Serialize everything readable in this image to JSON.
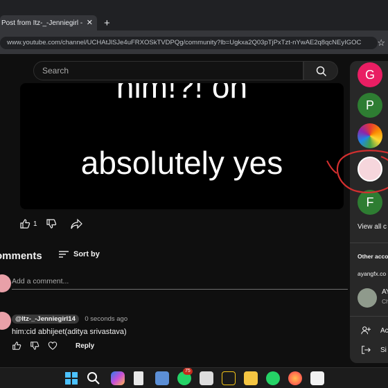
{
  "browser": {
    "tab_title": "Post from Itz-_-Jenniegirl - You",
    "tab_close": "✕",
    "new_tab": "+",
    "url": "www.youtube.com/channel/UCHAtJlSJe4uFRXOSkTVDPQg/community?lb=Ugkxa2Q03pTjPxTzt-nYwAE2q8qcNEyIGOC"
  },
  "header": {
    "search_placeholder": "Search"
  },
  "post": {
    "line1": "him!?! oh",
    "line2": "absolutely yes",
    "like_count": "1"
  },
  "comments": {
    "heading": "omments",
    "sort_label": "Sort by",
    "add_placeholder": "Add a comment...",
    "items": [
      {
        "handle": "@Itz-_-Jenniegirl14",
        "time": "0 seconds ago",
        "text": "him:cid abhijeet(aditya srivastava)",
        "reply_label": "Reply"
      }
    ]
  },
  "account_panel": {
    "accounts": [
      {
        "letter": "G",
        "color": "#e91e63"
      },
      {
        "letter": "P",
        "color": "#2e7d32"
      },
      {
        "letter": "",
        "color": "#f4b400"
      },
      {
        "letter": "",
        "color": "#f6d6dc"
      },
      {
        "letter": "F",
        "color": "#2e7d32"
      }
    ],
    "view_all": "View all c",
    "other_accounts": "Other accou",
    "email": "ayangfx.co",
    "account2_name": "AY",
    "account2_sub": "Ch",
    "row1_label": "Ac",
    "row2_label": "Si"
  },
  "taskbar": {
    "badge": "75"
  },
  "colors": {
    "annotation": "#d32f2f"
  }
}
